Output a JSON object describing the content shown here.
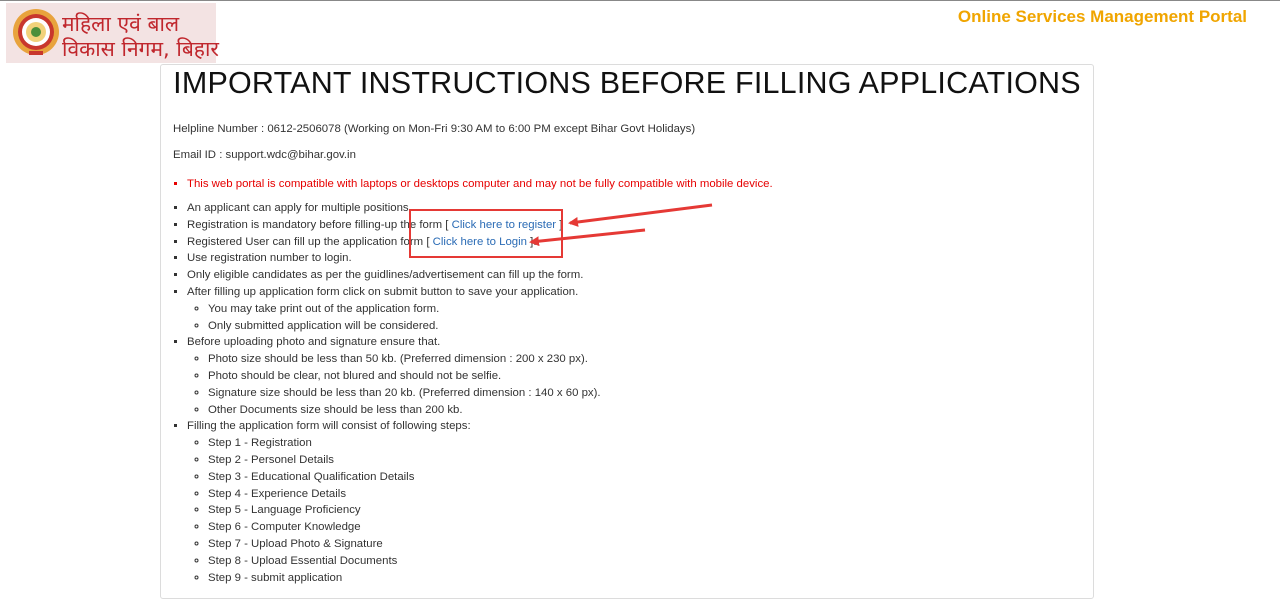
{
  "header": {
    "logo_line1": "महिला एवं बाल",
    "logo_line2": "विकास निगम, बिहार",
    "portal_title": "Online Services Management Portal"
  },
  "instructions": {
    "title": "IMPORTANT INSTRUCTIONS BEFORE FILLING APPLICATIONS",
    "helpline": "Helpline Number : 0612-2506078 (Working on Mon-Fri 9:30 AM to 6:00 PM except Bihar Govt Holidays)",
    "email": "Email ID : support.wdc@bihar.gov.in",
    "compat_note": "This web portal is compatible with laptops or desktops computer and may not be fully compatible with mobile device.",
    "items": {
      "multiple": "An applicant can apply for multiple positions.",
      "reg_pre": "Registration is mandatory before filling-up the form [ ",
      "reg_link": "Click here to register",
      "reg_post": " ]",
      "login_pre": "Registered User can fill up the application form [ ",
      "login_link": "Click here to Login",
      "login_post": " ].",
      "use_reg": "Use registration number to login.",
      "eligible": "Only eligible candidates as per the guidlines/advertisement can fill up the form.",
      "after_submit": "After filling up application form click on submit button to save your application.",
      "after_sub": [
        "You may take print out of the application form.",
        "Only submitted application will be considered."
      ],
      "upload": "Before uploading photo and signature ensure that.",
      "upload_sub": [
        "Photo size should be less than 50 kb. (Preferred dimension : 200 x 230 px).",
        "Photo should be clear, not blured and should not be selfie.",
        "Signature size should be less than 20 kb. (Preferred dimension : 140 x 60 px).",
        "Other Documents size should be less than 200 kb."
      ],
      "steps_intro": "Filling the application form will consist of following steps:",
      "steps": [
        "Step 1 - Registration",
        "Step 2 - Personel Details",
        "Step 3 - Educational Qualification Details",
        "Step 4 - Experience Details",
        "Step 5 - Language Proficiency",
        "Step 6 - Computer Knowledge",
        "Step 7 - Upload Photo & Signature",
        "Step 8 - Upload Essential Documents",
        "Step 9 - submit application"
      ]
    }
  },
  "colors": {
    "accent": "#f0a500",
    "link": "#2a6bb5",
    "alert": "#e60000",
    "annotation": "#e53935"
  }
}
